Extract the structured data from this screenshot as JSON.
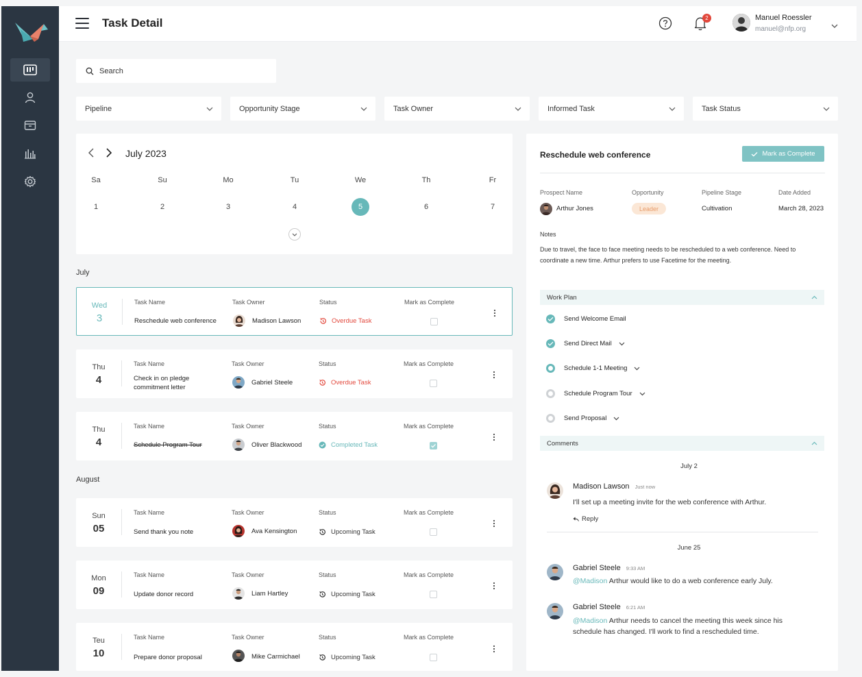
{
  "header": {
    "title": "Task Detail",
    "notification_count": "2",
    "user": {
      "name": "Manuel Roessler",
      "email": "manuel@nfp.org"
    }
  },
  "search": {
    "placeholder": "Search"
  },
  "filters": [
    "Pipeline",
    "Opportunity Stage",
    "Task Owner",
    "Informed Task",
    "Task Status"
  ],
  "calendar": {
    "month": "July 2023",
    "days": [
      {
        "dow": "Sa",
        "date": "1"
      },
      {
        "dow": "Su",
        "date": "2"
      },
      {
        "dow": "Mo",
        "date": "3"
      },
      {
        "dow": "Tu",
        "date": "4"
      },
      {
        "dow": "We",
        "date": "5"
      },
      {
        "dow": "Th",
        "date": "6"
      },
      {
        "dow": "Fr",
        "date": "7"
      }
    ],
    "selected_date": "5"
  },
  "task_columns": {
    "name": "Task Name",
    "owner": "Task Owner",
    "status": "Status",
    "complete": "Mark as Complete"
  },
  "groups": {
    "july": "July",
    "august": "August"
  },
  "tasks": [
    {
      "day": "Wed",
      "date": "3",
      "name": "Reschedule web conference",
      "owner": "Madison Lawson",
      "status": "Overdue Task"
    },
    {
      "day": "Thu",
      "date": "4",
      "name": "Check in on pledge commitment letter",
      "owner": "Gabriel Steele",
      "status": "Overdue Task"
    },
    {
      "day": "Thu",
      "date": "4",
      "name": "Schedule Program Tour",
      "owner": "Oliver Blackwood",
      "status": "Completed Task"
    },
    {
      "day": "Sun",
      "date": "05",
      "name": "Send thank you note",
      "owner": "Ava Kensington",
      "status": "Upcoming Task"
    },
    {
      "day": "Mon",
      "date": "09",
      "name": "Update donor record",
      "owner": "Liam Hartley",
      "status": "Upcoming Task"
    },
    {
      "day": "Teu",
      "date": "10",
      "name": "Prepare donor proposal",
      "owner": "Mike Carmichael",
      "status": "Upcoming Task"
    }
  ],
  "detail": {
    "title": "Reschedule web conference",
    "complete_button": "Mark as Complete",
    "labels": {
      "prospect": "Prospect Name",
      "opportunity": "Opportunity",
      "stage": "Pipeline Stage",
      "date": "Date Added"
    },
    "prospect": "Arthur Jones",
    "opportunity": "Leader",
    "stage": "Cultivation",
    "date_added": "March 28, 2023",
    "notes_label": "Notes",
    "notes": "Due to travel, the face to face meeting needs to be rescheduled to a web conference. Need to coordinate a new time. Arthur prefers to use Facetime for the meeting.",
    "work_plan_label": "Work Plan",
    "work_plan": [
      {
        "label": "Send Welcome Email"
      },
      {
        "label": "Send Direct Mail"
      },
      {
        "label": "Schedule 1-1 Meeting"
      },
      {
        "label": "Schedule Program Tour"
      },
      {
        "label": "Send Proposal"
      }
    ],
    "comments_label": "Comments",
    "comment_groups": [
      {
        "date": "July 2"
      },
      {
        "date": "June 25"
      }
    ],
    "comments": [
      {
        "name": "Madison Lawson",
        "time": "Just now",
        "mention": "",
        "text": "I'll set up a meeting invite for the web conference with Arthur."
      },
      {
        "name": "Gabriel Steele",
        "time": "9:33 AM",
        "mention": "@Madison",
        "text": " Arthur would like to do a web conference early July."
      },
      {
        "name": "Gabriel Steele",
        "time": "6:21 AM",
        "mention": "@Madison",
        "text": " Arthur needs to cancel the meeting this week since his schedule has changed. I'll work to find a rescheduled time."
      }
    ],
    "reply_label": "Reply"
  },
  "colors": {
    "accent": "#67b8b9",
    "sidebar": "#2b3642",
    "overdue": "#e2473b"
  }
}
